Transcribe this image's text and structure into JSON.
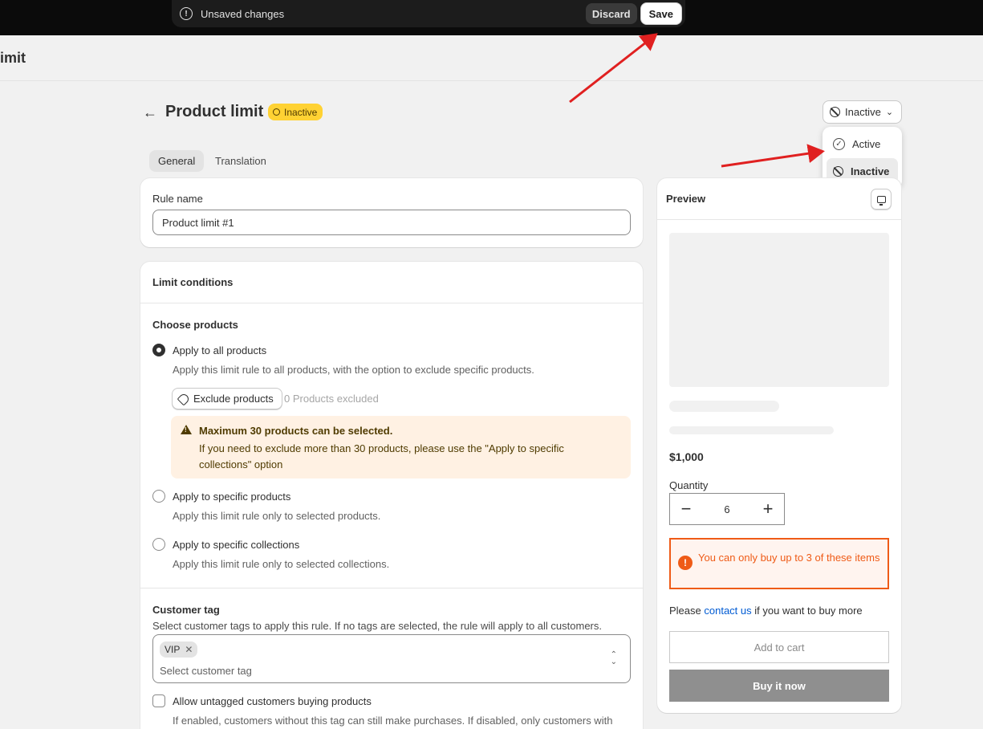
{
  "savebar": {
    "message": "Unsaved changes",
    "discard": "Discard",
    "save": "Save"
  },
  "app": {
    "title": "imit"
  },
  "header": {
    "back": "←",
    "title": "Product limit",
    "badge": "Inactive"
  },
  "status_select": {
    "selected": "Inactive",
    "options": [
      {
        "label": "Active"
      },
      {
        "label": "Inactive"
      }
    ]
  },
  "tabs": [
    {
      "label": "General"
    },
    {
      "label": "Translation"
    }
  ],
  "rule": {
    "label": "Rule name",
    "value": "Product limit #1"
  },
  "conditions": {
    "title": "Limit conditions",
    "choose_title": "Choose products",
    "options": [
      {
        "label": "Apply to all products",
        "help": "Apply this limit rule to all products, with the option to exclude specific products."
      },
      {
        "label": "Apply to specific products",
        "help": "Apply this limit rule only to selected products."
      },
      {
        "label": "Apply to specific collections",
        "help": "Apply this limit rule only to selected collections."
      }
    ],
    "exclude_button": "Exclude products",
    "excluded_count": "0 Products excluded",
    "banner": {
      "title": "Maximum 30 products can be selected.",
      "body": "If you need to exclude more than 30 products, please use the \"Apply to specific collections\" option"
    },
    "customer_tag": {
      "title": "Customer tag",
      "help": "Select customer tags to apply this rule. If no tags are selected, the rule will apply to all customers.",
      "chips": [
        "VIP"
      ],
      "placeholder": "Select customer tag",
      "untagged_label": "Allow untagged customers buying products",
      "untagged_help": "If enabled, customers without this tag can still make purchases. If disabled, only customers with"
    }
  },
  "preview": {
    "title": "Preview",
    "price": "$1,000",
    "quantity_label": "Quantity",
    "quantity": "6",
    "limit_message": "You can only buy up to 3 of these items",
    "contact_prefix": "Please",
    "contact_link": "contact us",
    "contact_suffix": "if you want to buy more",
    "add_to_cart": "Add to cart",
    "buy_now": "Buy it now"
  },
  "colors": {
    "badge": "#ffd233",
    "limit": "#ef5b17",
    "link": "#005bd3",
    "arrow": "#e02020"
  }
}
